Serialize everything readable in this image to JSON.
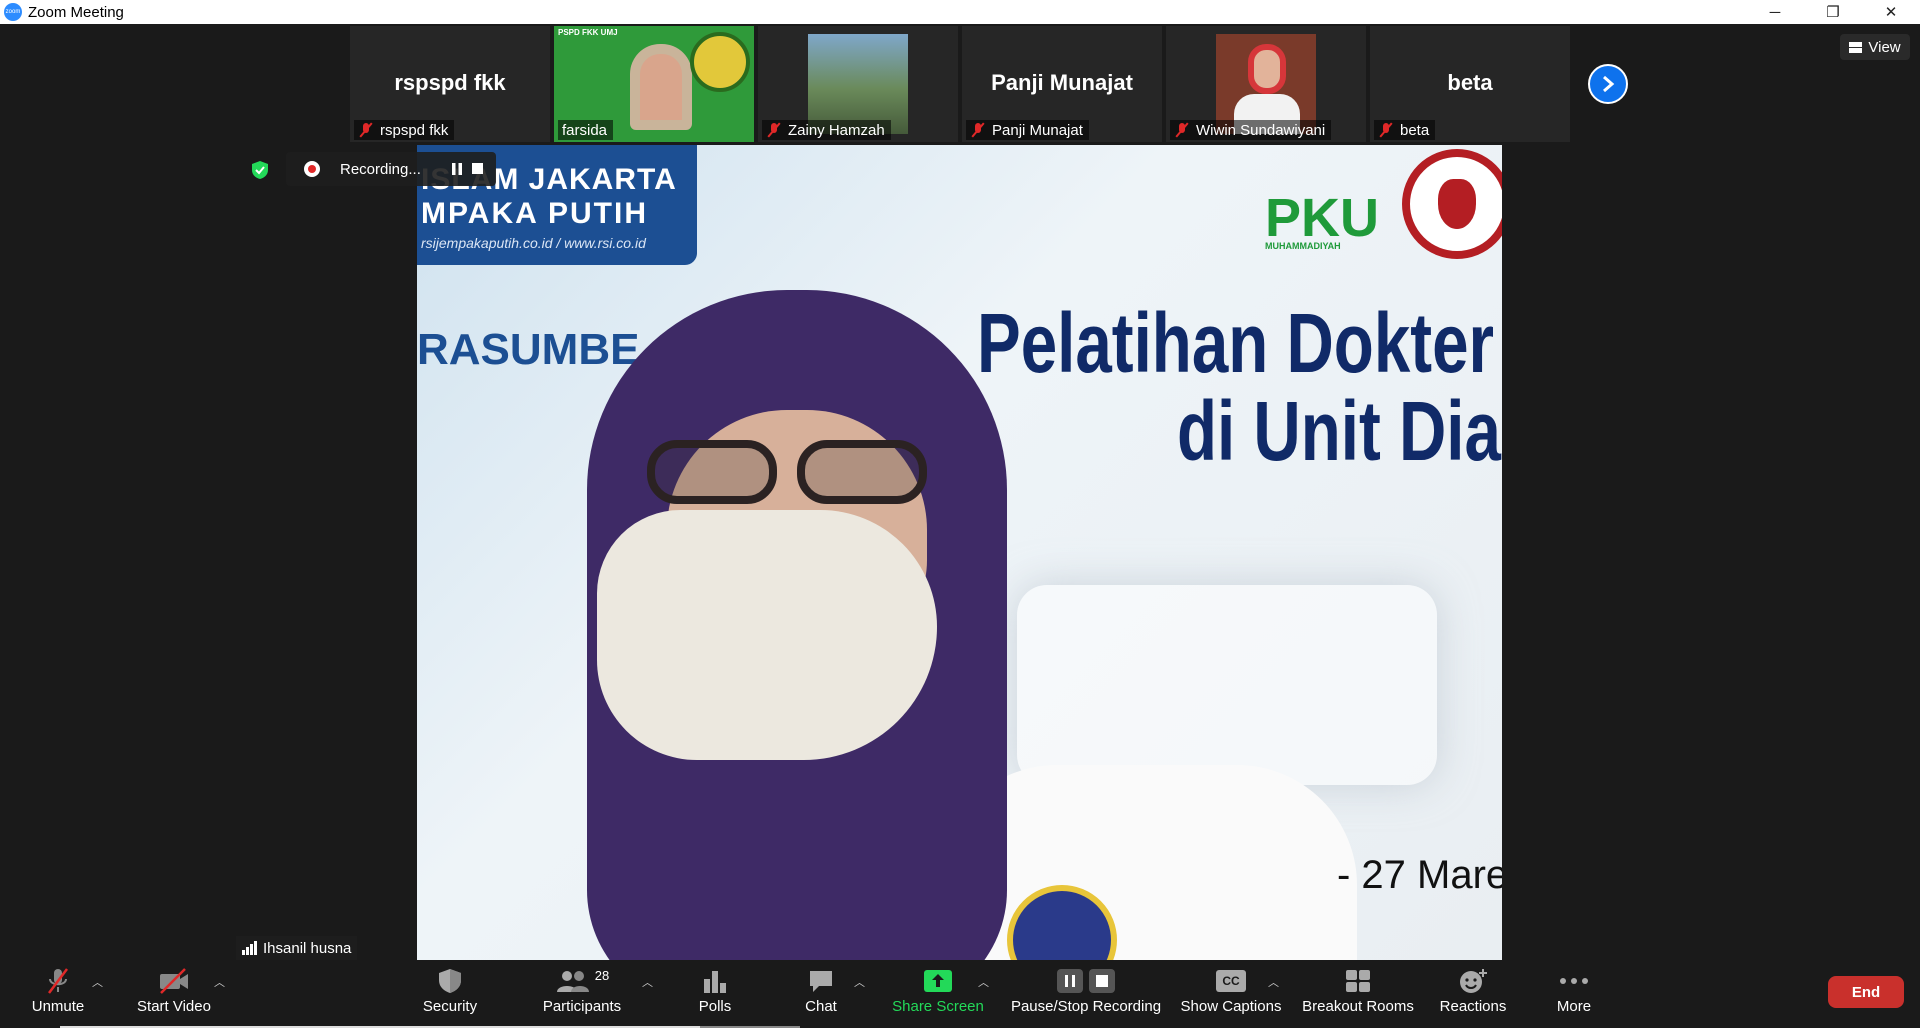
{
  "window": {
    "title": "Zoom Meeting",
    "logo_text": "zoom"
  },
  "window_controls": {
    "minimize": "─",
    "restore": "❐",
    "close": "✕"
  },
  "thumbnails": [
    {
      "big_name": "rspspd fkk",
      "label": "rspspd fkk",
      "muted": true
    },
    {
      "big_name": "",
      "label": "farsida",
      "muted": false,
      "banner": "PSPD FKK UMJ"
    },
    {
      "big_name": "",
      "label": "Zainy Hamzah",
      "muted": true
    },
    {
      "big_name": "Panji Munajat",
      "label": "Panji Munajat",
      "muted": true
    },
    {
      "big_name": "",
      "label": "Wiwin Sundawiyani",
      "muted": true
    },
    {
      "big_name": "beta",
      "label": "beta",
      "muted": true
    }
  ],
  "next_page_icon": "chevron-right-icon",
  "view_button": {
    "label": "View"
  },
  "recording": {
    "text": "Recording..."
  },
  "main_video": {
    "banner_line1": "ISLAM JAKARTA",
    "banner_line2": "MPAKA PUTIH",
    "banner_line3": "rsijempakaputih.co.id / www.rsi.co.id",
    "narasumber": "RASUMBE",
    "title_line1": "Pelatihan Dokter J",
    "title_line2": "di Unit Dia",
    "date": "- 27 Mare",
    "pku": "PKU",
    "pku_sub": "MUHAMMADIYAH"
  },
  "speaker": {
    "name": "Ihsanil husna"
  },
  "toolbar": {
    "unmute": "Unmute",
    "start_video": "Start Video",
    "security": "Security",
    "participants": "Participants",
    "participants_count": "28",
    "polls": "Polls",
    "chat": "Chat",
    "share_screen": "Share Screen",
    "pause_stop_recording": "Pause/Stop Recording",
    "show_captions": "Show Captions",
    "captions_icon_text": "CC",
    "breakout_rooms": "Breakout Rooms",
    "reactions": "Reactions",
    "more": "More",
    "end": "End"
  },
  "colors": {
    "accent": "#0e72ed",
    "share_green": "#23d959",
    "end_red": "#c9302c",
    "muted_red": "#e02828"
  }
}
